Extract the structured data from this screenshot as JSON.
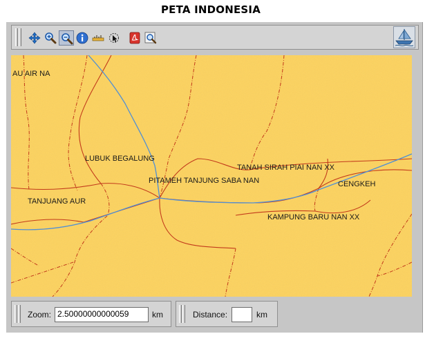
{
  "title": "PETA INDONESIA",
  "toolbar": {
    "tools": [
      {
        "name": "pan-icon"
      },
      {
        "name": "zoom-in-icon"
      },
      {
        "name": "zoom-out-icon"
      },
      {
        "name": "info-icon"
      },
      {
        "name": "measure-icon"
      },
      {
        "name": "select-icon"
      },
      {
        "name": "pdf-export-icon"
      },
      {
        "name": "zoom-window-icon"
      }
    ],
    "logo": "ship-logo-icon"
  },
  "map": {
    "places": [
      {
        "label": "AU AIR NA"
      },
      {
        "label": "LUBUK BEGALUNG"
      },
      {
        "label": "PITAMEH TANJUNG SABA NAN"
      },
      {
        "label": "TANAH SIRAH PIAI NAN XX"
      },
      {
        "label": "CENGKEH"
      },
      {
        "label": "TANJUANG AUR"
      },
      {
        "label": "KAMPUNG BARU NAN XX"
      }
    ],
    "colors": {
      "land": "#fcd25e",
      "road": "#c2391b",
      "river": "#4f8fd6"
    }
  },
  "status": {
    "zoom_label": "Zoom:",
    "zoom_value": "2.50000000000059",
    "zoom_unit": "km",
    "distance_label": "Distance:",
    "distance_value": "",
    "distance_unit": "km"
  }
}
